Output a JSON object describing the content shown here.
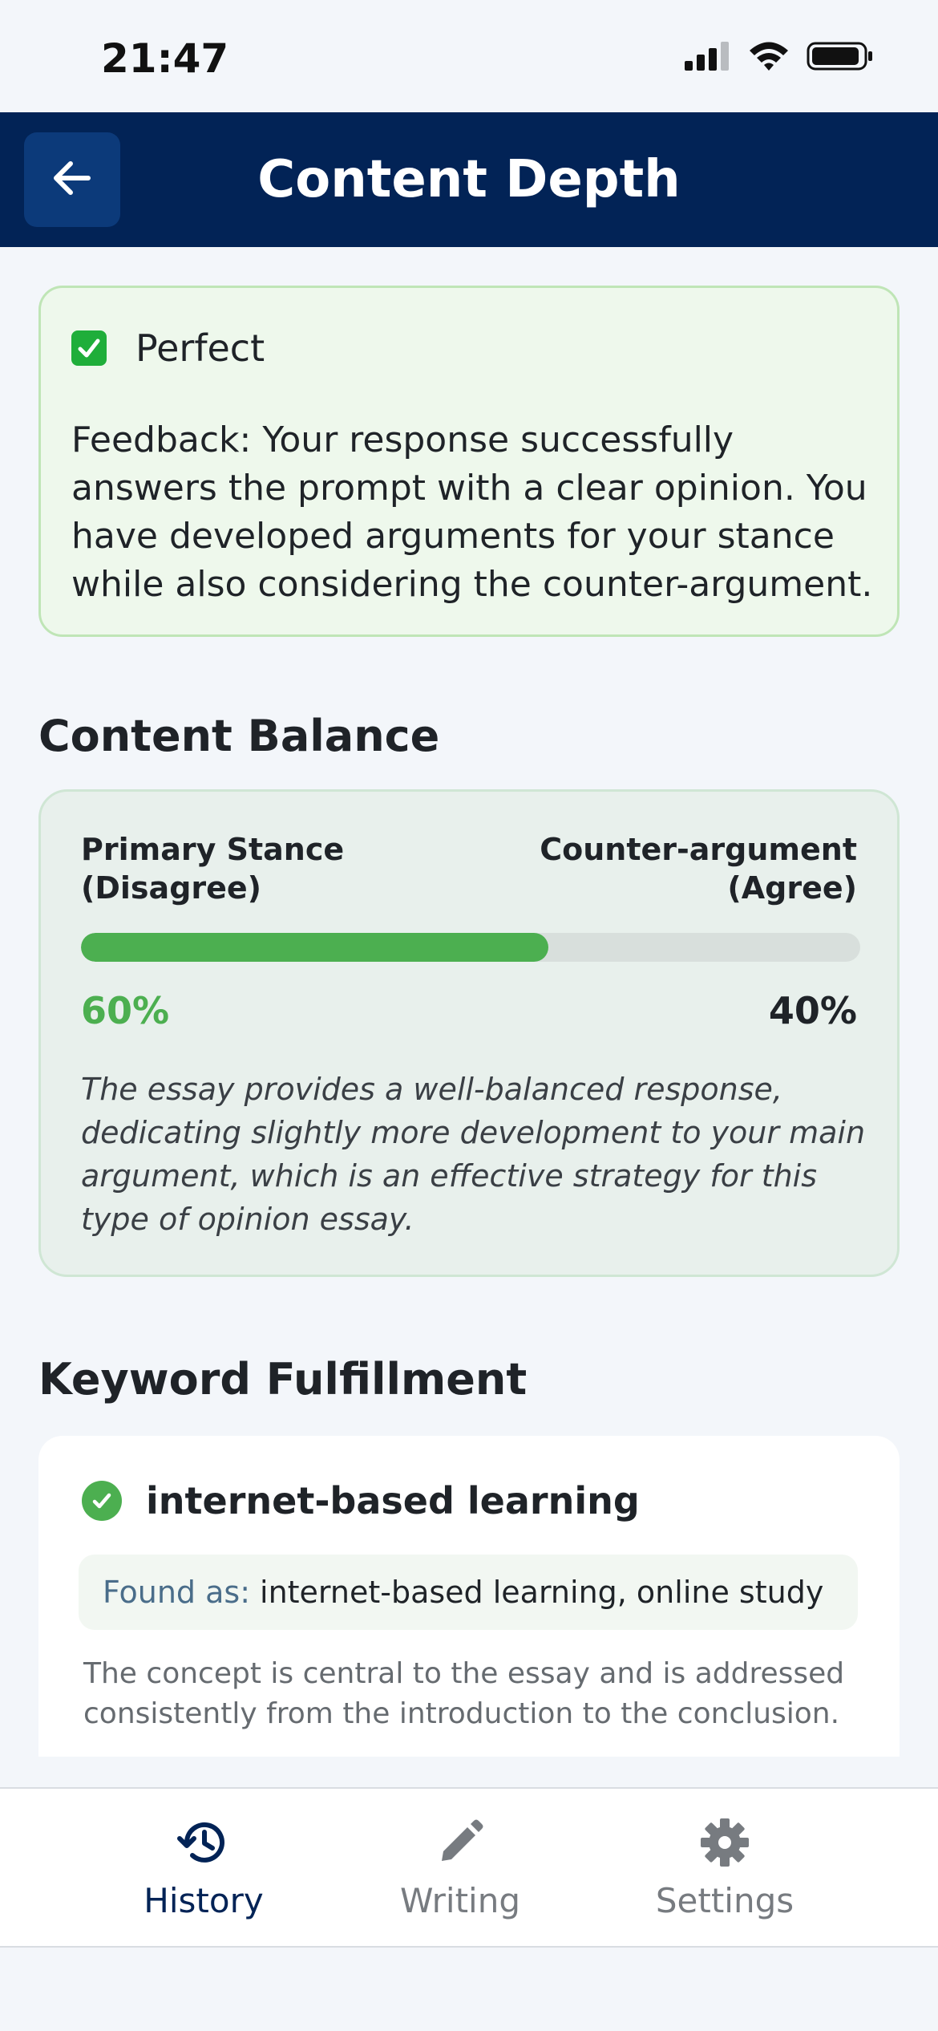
{
  "status_bar": {
    "time": "21:47",
    "icons": [
      "signal-icon",
      "wifi-icon",
      "battery-icon"
    ]
  },
  "header": {
    "title": "Content Depth",
    "back_icon": "arrow-left-icon"
  },
  "feedback": {
    "status": "Perfect",
    "status_icon": "check-box-icon",
    "text": "Feedback: Your response successfully answers the prompt with a clear opinion. You have developed arguments for your stance while also considering the counter-argument."
  },
  "content_balance": {
    "title": "Content Balance",
    "primary_label_line1": "Primary Stance",
    "primary_label_line2": "(Disagree)",
    "counter_label_line1": "Counter-argument",
    "counter_label_line2": "(Agree)",
    "primary_percent": "60%",
    "counter_percent": "40%",
    "primary_fraction": 0.6,
    "note": "The essay provides a well-balanced response, dedicating slightly more development to your main argument, which is an effective strategy for this type of opinion essay."
  },
  "keyword_fulfillment": {
    "title": "Keyword Fulfillment",
    "items": [
      {
        "keyword": "internet-based learning",
        "found_label": "Found as:",
        "found_value": "internet-based learning, online study",
        "note": "The concept is central to the essay and is addressed consistently from the introduction to the conclusion."
      }
    ]
  },
  "bottom_nav": {
    "items": [
      {
        "label": "History",
        "icon": "history-icon",
        "active": true
      },
      {
        "label": "Writing",
        "icon": "pencil-icon",
        "active": false
      },
      {
        "label": "Settings",
        "icon": "gear-icon",
        "active": false
      }
    ]
  },
  "colors": {
    "header_bg": "#022356",
    "accent_green": "#4caf50",
    "feedback_bg": "#eef8ec",
    "balance_bg": "#e8f0ec"
  }
}
